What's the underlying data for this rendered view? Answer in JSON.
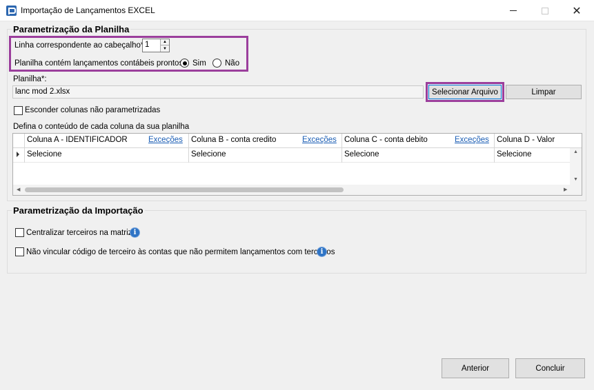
{
  "window": {
    "title": "Importação de Lançamentos EXCEL"
  },
  "section_planilha": {
    "title": "Parametrização da Planilha",
    "header_line_label": "Linha correspondente ao cabeçalho*",
    "header_line_value": "1",
    "ready_label": "Planilha contém lançamentos contábeis prontos:",
    "radio_yes": "Sim",
    "radio_no": "Não",
    "radio_selected": "Sim",
    "file_label": "Planilha*:",
    "file_value": "lanc mod 2.xlsx",
    "select_button": "Selecionar Arquivo",
    "clear_button": "Limpar",
    "hide_columns_label": "Esconder colunas não parametrizadas",
    "hide_columns_checked": false,
    "define_label": "Defina o conteúdo de cada coluna da sua planilha"
  },
  "grid": {
    "columns": [
      {
        "header": "Coluna A - IDENTIFICADOR",
        "link": "Exceções",
        "value": "Selecione"
      },
      {
        "header": "Coluna B - conta credito",
        "link": "Exceções",
        "value": "Selecione"
      },
      {
        "header": "Coluna C - conta debito",
        "link": "Exceções",
        "value": "Selecione"
      },
      {
        "header": "Coluna D - Valor",
        "link": "",
        "value": "Selecione"
      }
    ]
  },
  "section_importacao": {
    "title": "Parametrização da Importação",
    "centralize_label": "Centralizar terceiros na matriz",
    "centralize_checked": false,
    "no_link_label": "Não vincular código de terceiro às contas que não permitem lançamentos com terceiros",
    "no_link_checked": false
  },
  "footer": {
    "back_button": "Anterior",
    "finish_button": "Concluir"
  },
  "colors": {
    "highlight": "#9b3e9c",
    "link": "#1a5db4",
    "info": "#2f74c5"
  }
}
